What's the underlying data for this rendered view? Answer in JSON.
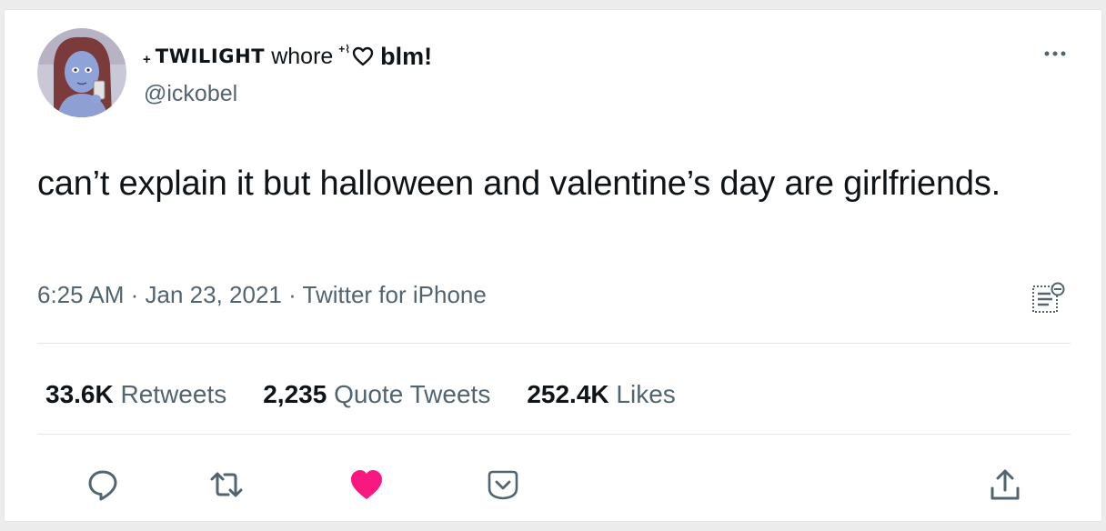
{
  "user": {
    "display_name_prefix": "+",
    "display_name_caps": "TWILIGHT",
    "display_name_rest": "whore",
    "display_name_sup": "+⌇",
    "display_name_bold": "blm!",
    "handle": "@ickobel",
    "avatar_icon": "profile-avatar"
  },
  "tweet": {
    "text": "can’t explain it but halloween and valentine’s day are girlfriends.",
    "time": "6:25 AM",
    "date": "Jan 23, 2021",
    "source": "Twitter for iPhone",
    "separator": " · "
  },
  "stats": {
    "retweets_count": "33.6K",
    "retweets_label": "Retweets",
    "quotes_count": "2,235",
    "quotes_label": "Quote Tweets",
    "likes_count": "252.4K",
    "likes_label": "Likes"
  },
  "actions": {
    "reply_icon": "reply-icon",
    "retweet_icon": "retweet-icon",
    "like_icon": "heart-filled-icon",
    "tip_icon": "tip-icon",
    "share_icon": "share-icon",
    "like_color": "#f91880",
    "icon_color": "#536471"
  },
  "colors": {
    "text": "#0f1419",
    "secondary": "#536471",
    "divider": "#e1e8ed",
    "background": "#ffffff"
  }
}
